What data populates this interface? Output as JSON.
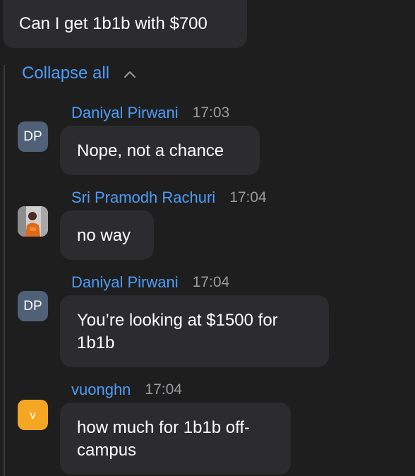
{
  "parent_message": {
    "text": "Can I get 1b1b with $700"
  },
  "thread": {
    "collapse_label": "Collapse all"
  },
  "colors": {
    "background": "#1e1e1e",
    "bubble": "#2c2c2e",
    "accent": "#4a9df8",
    "timestamp": "#9a9a9f",
    "avatar_dp": "#4f6077",
    "avatar_v": "#f5a623"
  },
  "replies": [
    {
      "author": "Daniyal Pirwani",
      "time": "17:03",
      "avatar_initials": "DP",
      "text": "Nope, not a chance"
    },
    {
      "author": "Sri Pramodh Rachuri",
      "time": "17:04",
      "avatar_type": "photo",
      "text": "no way"
    },
    {
      "author": "Daniyal Pirwani",
      "time": "17:04",
      "avatar_initials": "DP",
      "text_line1": "You’re looking at $1500 for",
      "text_line2": "1b1b"
    },
    {
      "author": "vuonghn",
      "time": "17:04",
      "avatar_initials": "v",
      "text_line1": "how much for 1b1b off-",
      "text_line2": "campus"
    }
  ]
}
